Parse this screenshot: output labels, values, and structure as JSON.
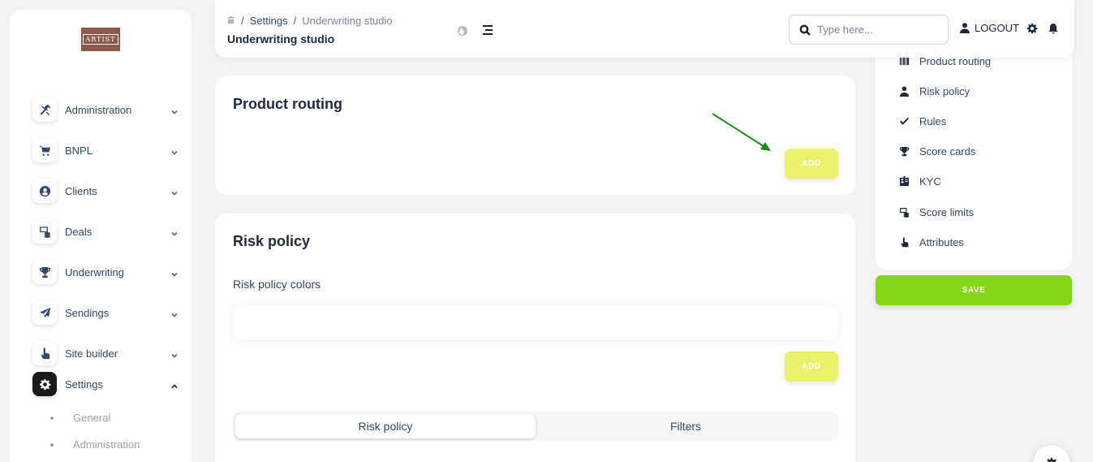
{
  "sidebar": {
    "logo_text": "ARTIST",
    "items": [
      {
        "label": "Administration",
        "icon": "tools-icon"
      },
      {
        "label": "BNPL",
        "icon": "cart-icon"
      },
      {
        "label": "Clients",
        "icon": "user-circle-icon"
      },
      {
        "label": "Deals",
        "icon": "coins-icon"
      },
      {
        "label": "Underwriting",
        "icon": "trophy-icon"
      },
      {
        "label": "Sendings",
        "icon": "send-icon"
      },
      {
        "label": "Site builder",
        "icon": "pointer-hand-icon"
      },
      {
        "label": "Settings",
        "icon": "gear-icon"
      }
    ],
    "sub_items": [
      "General",
      "Administration"
    ]
  },
  "topbar": {
    "breadcrumb": [
      "Settings",
      "Underwriting studio"
    ],
    "title": "Underwriting studio",
    "search_placeholder": "Type here...",
    "logout_label": "LOGOUT"
  },
  "product_routing": {
    "title": "Product routing",
    "add_label": "ADD"
  },
  "risk_policy": {
    "title": "Risk policy",
    "colors_label": "Risk policy colors",
    "add_label": "ADD",
    "tabs": [
      "Risk policy",
      "Filters"
    ]
  },
  "right_nav": {
    "items": [
      {
        "label": "Product routing",
        "icon": "barcode-icon"
      },
      {
        "label": "Risk policy",
        "icon": "user-icon"
      },
      {
        "label": "Rules",
        "icon": "check-icon"
      },
      {
        "label": "Score cards",
        "icon": "trophy-icon"
      },
      {
        "label": "KYC",
        "icon": "id-card-icon"
      },
      {
        "label": "Score limits",
        "icon": "coins-icon"
      },
      {
        "label": "Attributes",
        "icon": "pointer-hand-icon"
      }
    ],
    "save_label": "SAVE"
  },
  "colors": {
    "add_button": "#e9f26a",
    "save_button": "#82d616",
    "annotation_arrow": "#1a8a1a"
  }
}
